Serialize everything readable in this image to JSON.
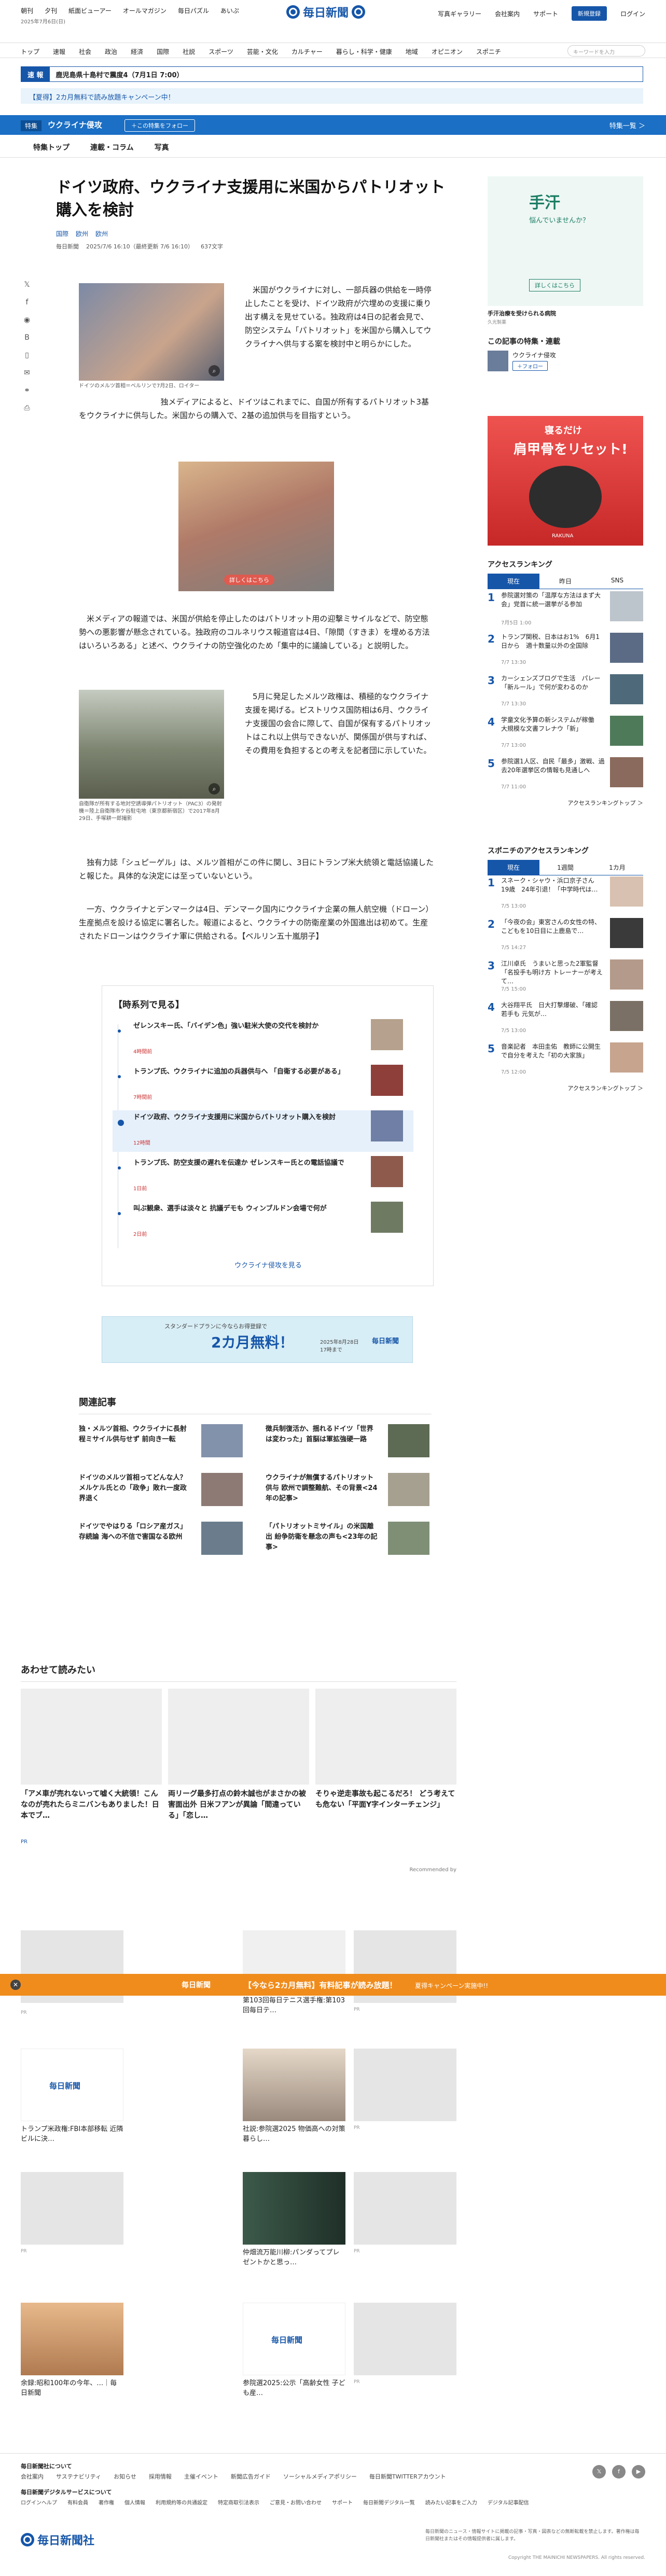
{
  "utility": {
    "links": [
      "朝刊",
      "夕刊",
      "紙面ビューアー",
      "オールマガジン",
      "毎日パズル",
      "あいぷ"
    ],
    "date": "2025年7月6日(日)",
    "logo": "毎日新聞",
    "right": [
      "写真ギャラリー",
      "会社案内",
      "サポート"
    ],
    "register": "新規登録",
    "login": "ログイン"
  },
  "nav": {
    "items": [
      "トップ",
      "速報",
      "社会",
      "政治",
      "経済",
      "国際",
      "社説",
      "スポーツ",
      "芸能・文化",
      "カルチャー",
      "暮らし・科学・健康",
      "地域",
      "オピニオン",
      "スポニチ"
    ],
    "search_placeholder": "キーワードを入力"
  },
  "breaking": {
    "tag": "速 報",
    "text": "鹿児島県十島村で震度4（7月1日 7:00）"
  },
  "campaign": "【夏得】2カ月無料で読み放題キャンペーン中！",
  "feature": {
    "tag": "特集",
    "name": "ウクライナ侵攻",
    "follow": "＋この特集をフォロー",
    "list": "特集一覧 ＞"
  },
  "subnav": [
    "特集トップ",
    "連載・コラム",
    "写真"
  ],
  "share_icons": [
    "x-icon",
    "facebook-icon",
    "line-icon",
    "hatena-icon",
    "bookmark-icon",
    "mail-icon",
    "link-icon",
    "print-icon"
  ],
  "article": {
    "headline": "ドイツ政府、ウクライナ支援用に米国からパトリオット購入を検討",
    "categories": [
      "国際",
      "欧州",
      "欧州"
    ],
    "meta": [
      "毎日新聞",
      "2025/7/6 16:10（最終更新 7/6 16:10）",
      "637文字"
    ],
    "p1": "米国がウクライナに対し、一部兵器の供給を一時停止したことを受け、ドイツ政府が穴埋めの支援に乗り出す構えを見せている。独政府は4日の記者会見で、防空システム「パトリオット」を米国から購入してウクライナへ供与する案を検討中と明らかにした。",
    "p2": "独メディアによると、ドイツはこれまでに、自国が所有するパトリオット3基をウクライナに供与した。米国からの購入で、2基の追加供与を目指すという。",
    "fig1_caption": "ドイツのメルツ首相＝ベルリンで7月2日、ロイター",
    "ad_caption": "詳しくはこちら",
    "p3": "米メディアの報道では、米国が供給を停止したのはパトリオット用の迎撃ミサイルなどで、防空態勢への悪影響が懸念されている。独政府のコルネリウス報道官は4日、「隙間（すきま）を埋める方法はいろいろある」と述べ、ウクライナの防空強化のため「集中的に議論している」と説明した。",
    "p4": "5月に発足したメルツ政権は、積極的なウクライナ支援を掲げる。ピストリウス国防相は6月、ウクライナ支援国の会合に際して、自国が保有するパトリオットはこれ以上供与できないが、関係国が供与すれば、その費用を負担するとの考えを記者団に示していた。",
    "fig2_caption": "自衛隊が所有する地対空誘導弾パトリオット（PAC3）の発射機＝陸上自衛隊市ケ谷駐屯地（東京都新宿区）で2017年8月29日、手塚耕一郎撮影",
    "p5": "独有力誌「シュピーゲル」は、メルツ首相がこの件に関し、3日にトランプ米大統領と電話協議したと報じた。具体的な決定には至っていないという。",
    "p6": "一方、ウクライナとデンマークは4日、デンマーク国内にウクライナ企業の無人航空機（ドローン）生産拠点を設ける協定に署名した。報道によると、ウクライナの防衛産業の外国進出は初めて。生産されたドローンはウクライナ軍に供給される。【ベルリン五十嵐朋子】"
  },
  "timeline": {
    "title": "【時系列で見る】",
    "items": [
      {
        "title": "ゼレンスキー氏、「バイデン色」強い駐米大使の交代を検討か",
        "when": "4時間前"
      },
      {
        "title": "トランプ氏、ウクライナに追加の兵器供与へ 「自衛する必要がある」",
        "when": "7時間前"
      },
      {
        "title": "ドイツ政府、ウクライナ支援用に米国からパトリオット購入を検討",
        "when": "12時間"
      },
      {
        "title": "トランプ氏、防空支援の遅れを伝達か ゼレンスキー氏との電話協議で",
        "when": "1日前"
      },
      {
        "title": "叫ぶ観衆、選手は淡々と 抗議デモも ウィンブルドン会場で何が",
        "when": "2日前"
      }
    ],
    "more": "ウクライナ侵攻を見る"
  },
  "banner": {
    "label": "スタンダードプランに今ならお得登録で",
    "big": "2カ月無料！",
    "date": "2025年8月28日17時まで",
    "logo": "毎日新聞"
  },
  "related": {
    "title": "関連記事",
    "items": [
      "独・メルツ首相、ウクライナに長射程ミサイル供与せず 前向き一転",
      "徴兵制復活か、揺れるドイツ「世界は変わった」首脳は軍拡強硬一路",
      "ドイツのメルツ首相ってどんな人？ メルケル氏との「政争」敗れ一度政界退く",
      "ウクライナが無償するパトリオット供与 欧州で調整難航、その背景<24年の記事>",
      "ドイツでやはりる「ロシア産ガス」存続論 海への不信で害国なる欧州",
      "「パトリオットミサイル」の米国離出 紛争防衛を懸念の声も<23年の記事>"
    ]
  },
  "also": {
    "title": "あわせて読みたい",
    "items": [
      "「アメ車が売れないって嘘く大統領！こんなのが売れたらミニバンもありました！日本でブ…",
      "両リーグ最多打点の鈴木誠也がまさかの被害面出外 日米フアンが異論「間違っている」「恋し…",
      "そりゃ逆走事故も起こるだろ！ どう考えても危ない「平面Y字インターチェンジ」"
    ],
    "sponsor": "PR",
    "recommended": "Recommended by"
  },
  "recommended": [
    {
      "title": "",
      "tag": "PR"
    },
    {
      "title": "第103回毎日テニス選手権:第103回毎日テ…",
      "tag": ""
    },
    {
      "title": "",
      "tag": "PR"
    },
    {
      "title": "トランプ米政権:FBI本部移転 近隣ビルに決…",
      "tag": ""
    },
    {
      "title": "社説:参院選2025 物価高への対策 暮らし…",
      "tag": ""
    },
    {
      "title": "",
      "tag": "PR"
    },
    {
      "title": "",
      "tag": "PR"
    },
    {
      "title": "仲畑流万能川柳:パンダってプレゼントかと思っ…",
      "tag": ""
    },
    {
      "title": "",
      "tag": "PR"
    },
    {
      "title": "余録:昭和100年の今年、…｜毎日新聞",
      "tag": ""
    },
    {
      "title": "参院選2025:公示「高齢女性 子ども産…",
      "tag": ""
    },
    {
      "title": "",
      "tag": "PR"
    }
  ],
  "orange_bar": {
    "logo": "毎日新聞",
    "msg": "【今なら2カ月無料】有料記事が読み放題！",
    "msg2": "夏得キャンペーン実施中!!"
  },
  "sidebar": {
    "ad1": {
      "title": "手汗",
      "sub": "悩んでいませんか？",
      "btn": "詳しくはこちら",
      "caption": "手汗治療を受けられる病院",
      "source": "久光製薬"
    },
    "follow_title": "この記事の特集・連載",
    "follow_name": "ウクライナ侵攻",
    "follow_btn": "＋フォロー",
    "ad2": {
      "title": "寝るだけ",
      "big": "肩甲骨をリセット!",
      "brand": "RAKUNA"
    },
    "ranking_title": "アクセスランキング",
    "ranking_tabs": [
      "現在",
      "昨日",
      "SNS"
    ],
    "ranking": [
      {
        "title": "参院選対策の「温厚な方法はまず大会」党首に統一選挙がる参加",
        "date": "7月5日 1:00"
      },
      {
        "title": "トランプ関税、日本はお1%　6月1日から　適十数量以外の全国除",
        "date": "7/7 13:30"
      },
      {
        "title": "カーシェンズブログで生活　パレー「新ルール」で何が変わるのか",
        "date": "7/7 13:30"
      },
      {
        "title": "学童文化予算の新システムが稼働　大規模な文書フレナウ「新」",
        "date": "7/7 13:00"
      },
      {
        "title": "参院選1人区、自民「最多」激戦、過去20年選挙区の情報も見通しへ",
        "date": "7/7 11:00"
      }
    ],
    "ranking_more": "アクセスランキングトップ ＞",
    "spn_title": "スポニチのアクセスランキング",
    "spn_tabs": [
      "現在",
      "1週間",
      "1カ月"
    ],
    "spn": [
      {
        "title": "スネーク・シャウ・浜口京子さん　19歳　24年引退！「中学時代は…",
        "date": "7/5 13:00"
      },
      {
        "title": "「今夜の会」東宮さんの女性の特、こどもを10日目に上鹿島で…",
        "date": "7/5 14:27"
      },
      {
        "title": "江川卓氏　うまいと思った2軍監督「名投手も明け方 トレーナーが考えて…",
        "date": "7/5 15:00"
      },
      {
        "title": "大谷翔平氏　日大打撃爆破、「確認 若手も 元気が…",
        "date": "7/5 13:00"
      },
      {
        "title": "音楽記者　本田圭佑　教師に公開生で自分を考えた「初の大家族」",
        "date": "7/5 12:00"
      }
    ],
    "spn_more": "アクセスランキングトップ ＞"
  },
  "footer": {
    "row1_title": "毎日新聞社について",
    "row1": [
      "会社案内",
      "サステナビリティ",
      "お知らせ",
      "採用情報",
      "主催イベント",
      "新聞広告ガイド",
      "ソーシャルメディアポリシー",
      "毎日新聞TWITTERアカウント"
    ],
    "row2_title": "毎日新聞デジタルサービスについて",
    "row2": [
      "ログインヘルプ",
      "有料会員",
      "著作権",
      "個人情報",
      "利用規約等の共通設定",
      "特定商取引法表示",
      "ご意見・お問い合わせ",
      "サポート",
      "毎日新聞デジタル一覧",
      "読みたい記事をご入力",
      "デジタル記事配信"
    ],
    "logo": "毎日新聞社",
    "notice": "毎日新聞のニュース・情報サイトに掲載の記事・写真・図表などの無断転載を禁止します。著作権は毎日新聞社またはその情報提供者に属します。",
    "copyright": "Copyright THE MAINICHI NEWSPAPERS. All rights reserved."
  }
}
